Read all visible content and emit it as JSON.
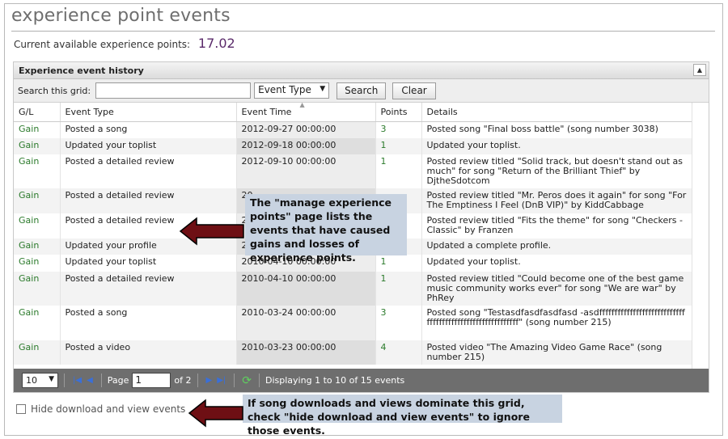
{
  "page": {
    "title": "experience point events",
    "xp_label": "Current available experience points:",
    "xp_value": "17.02"
  },
  "grid": {
    "title": "Experience event history",
    "search_label": "Search this grid:",
    "search_value": "",
    "filter_value": "Event Type",
    "search_button": "Search",
    "clear_button": "Clear",
    "columns": [
      "G/L",
      "Event Type",
      "Event Time",
      "Points",
      "Details"
    ],
    "rows": [
      {
        "gl": "Gain",
        "type": "Posted a song",
        "time": "2012-09-27 00:00:00",
        "points": "3",
        "details": "Posted song \"Final boss battle\" (song number 3038)"
      },
      {
        "gl": "Gain",
        "type": "Updated your toplist",
        "time": "2012-09-18 00:00:00",
        "points": "1",
        "details": "Updated your toplist."
      },
      {
        "gl": "Gain",
        "type": "Posted a detailed review",
        "time": "2012-09-10 00:00:00",
        "points": "1",
        "details": "Posted review titled \"Solid track, but doesn't stand out as much\" for song \"Return of the Brilliant Thief\" by DjtheSdotcom"
      },
      {
        "gl": "Gain",
        "type": "Posted a detailed review",
        "time": "20",
        "points": "",
        "details": "Posted review titled \"Mr. Peros does it again\" for song \"For The Emptiness I Feel (DnB VIP)\" by KiddCabbage"
      },
      {
        "gl": "Gain",
        "type": "Posted a detailed review",
        "time": "20",
        "points": "",
        "details": "Posted review titled \"Fits the theme\" for song \"Checkers - Classic\" by Franzen"
      },
      {
        "gl": "Gain",
        "type": "Updated your profile",
        "time": "20",
        "points": "",
        "details": "Updated a complete profile."
      },
      {
        "gl": "Gain",
        "type": "Updated your toplist",
        "time": "2010-04-10 00:00:00",
        "points": "1",
        "details": "Updated your toplist."
      },
      {
        "gl": "Gain",
        "type": "Posted a detailed review",
        "time": "2010-04-10 00:00:00",
        "points": "1",
        "details": "Posted review titled \"Could become one of the best game music community works ever\" for song \"We are war\" by PhRey"
      },
      {
        "gl": "Gain",
        "type": "Posted a song",
        "time": "2010-03-24 00:00:00",
        "points": "3",
        "details": "Posted song \"Testasdfasdfasdfasd -asdffffffffffffffffffffffffffffffffffffffffffffffffffffffffff\" (song number 215)"
      },
      {
        "gl": "Gain",
        "type": "Posted a video",
        "time": "2010-03-23 00:00:00",
        "points": "4",
        "details": "Posted video \"The Amazing Video Game Race\" (song number 215)"
      }
    ]
  },
  "pager": {
    "page_size": "10",
    "page_label": "Page",
    "page_value": "1",
    "of_label": "of 2",
    "status": "Displaying 1 to 10 of 15 events"
  },
  "hide_option": {
    "label": "Hide download and view events"
  },
  "callouts": {
    "manage": "The \"manage experience points\" page lists the events that have caused gains and losses of experience points.",
    "hide": "If song downloads and views dominate this grid, check \"hide download and view events\" to ignore those events."
  },
  "colors": {
    "gain_green": "#2b7a2b",
    "xp_purple": "#5a2a6a",
    "callout_bg": "#c8d3e1",
    "arrow_red": "#6e0f14",
    "pager_bg": "#6e6e6e"
  }
}
